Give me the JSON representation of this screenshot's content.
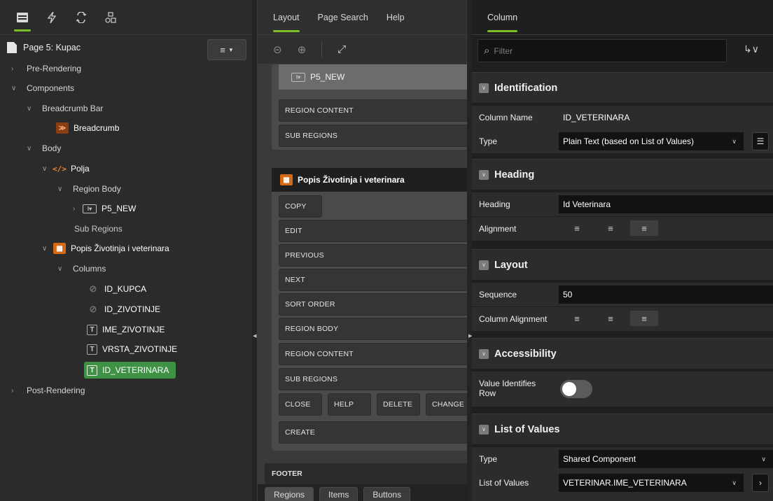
{
  "left": {
    "toolbar": {
      "icons": [
        "rendering-tree-icon",
        "dynamic-actions-icon",
        "processing-icon",
        "shared-components-icon"
      ]
    },
    "page_title": "Page 5: Kupac",
    "menu_icon": "≡",
    "tree": {
      "pre_rendering": "Pre-Rendering",
      "components": "Components",
      "breadcrumb_bar": "Breadcrumb Bar",
      "breadcrumb": "Breadcrumb",
      "body": "Body",
      "polja": "Polja",
      "region_body": "Region Body",
      "p5_new": "P5_NEW",
      "sub_regions": "Sub Regions",
      "popis": "Popis Životinja i veterinara",
      "columns": "Columns",
      "col_id_kupca": "ID_KUPCA",
      "col_id_zivotinje": "ID_ZIVOTINJE",
      "col_ime_zivotinje": "IME_ZIVOTINJE",
      "col_vrsta_zivotinje": "VRSTA_ZIVOTINJE",
      "col_id_veterinara": "ID_VETERINARA",
      "post_rendering": "Post-Rendering"
    }
  },
  "center": {
    "tabs": {
      "layout": "Layout",
      "page_search": "Page Search",
      "help": "Help"
    },
    "p5_new": "P5_NEW",
    "polja_slots": {
      "region_content": "REGION CONTENT",
      "sub_regions": "SUB REGIONS"
    },
    "region_title": "Popis Životinja i veterinara",
    "slots": {
      "copy": "COPY",
      "edit": "EDIT",
      "previous": "PREVIOUS",
      "next": "NEXT",
      "sort_order": "SORT ORDER",
      "region_body": "REGION BODY",
      "region_content": "REGION CONTENT",
      "sub_regions": "SUB REGIONS",
      "close": "CLOSE",
      "help": "HELP",
      "delete": "DELETE",
      "change": "CHANGE",
      "create": "CREATE"
    },
    "footer": "FOOTER",
    "bottom_tabs": {
      "regions": "Regions",
      "items": "Items",
      "buttons": "Buttons"
    }
  },
  "right": {
    "tab": "Column",
    "filter_placeholder": "Filter",
    "sections": {
      "identification": "Identification",
      "heading": "Heading",
      "layout": "Layout",
      "accessibility": "Accessibility",
      "list_of_values": "List of Values"
    },
    "props": {
      "column_name_label": "Column Name",
      "column_name_value": "ID_VETERINARA",
      "type_label": "Type",
      "type_value": "Plain Text (based on List of Values)",
      "heading_label": "Heading",
      "heading_value": "Id Veterinara",
      "alignment_label": "Alignment",
      "sequence_label": "Sequence",
      "sequence_value": "50",
      "column_alignment_label": "Column Alignment",
      "value_identifies_label_1": "Value Identifies",
      "value_identifies_label_2": "Row",
      "lov_type_label": "Type",
      "lov_type_value": "Shared Component",
      "lov_label": "List of Values",
      "lov_value": "VETERINAR.IME_VETERINARA"
    },
    "value_identifies_row_on": false,
    "heading_alignment_selected": "right",
    "column_alignment_selected": "right"
  },
  "colors": {
    "accent_green": "#7dbd2a",
    "selected_node": "#3f9146",
    "region_icon_orange": "#d46a17"
  }
}
